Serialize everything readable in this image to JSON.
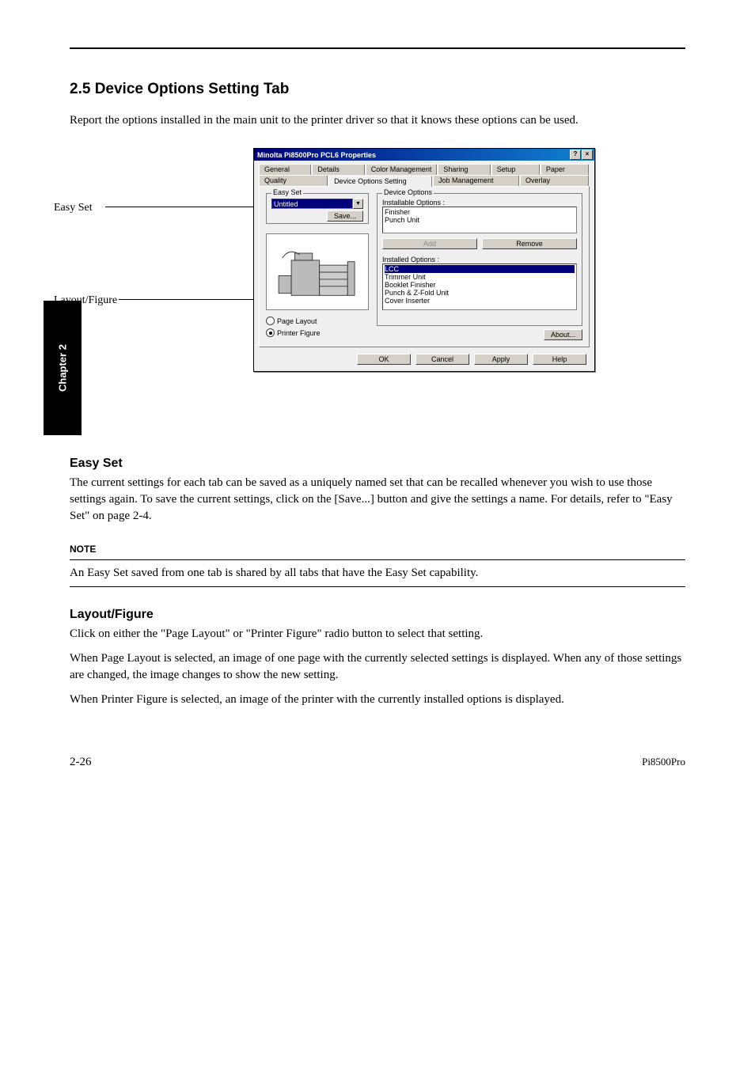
{
  "chapter_tab": "Chapter 2",
  "page_title_top": "",
  "section": {
    "heading": "2.5 Device Options Setting Tab",
    "intro": "Report the options installed in the main unit to the printer driver so that it knows these options can be used."
  },
  "figure": {
    "label_easyset": "Easy Set",
    "label_layout_figure": "Layout/Figure"
  },
  "dialog": {
    "title": "Minolta Pi8500Pro PCL6 Properties",
    "tabs_row1": [
      "General",
      "Details",
      "Color Management",
      "Sharing",
      "Setup",
      "Paper"
    ],
    "tabs_row2": [
      "Quality",
      "Device Options Setting",
      "Job Management",
      "Overlay"
    ],
    "active_tab": "Device Options Setting",
    "easy_set": {
      "group": "Easy Set",
      "combo_value": "Untitled",
      "save_btn": "Save..."
    },
    "layout_radio": {
      "page_layout": "Page Layout",
      "printer_figure": "Printer Figure"
    },
    "device_options": {
      "group": "Device Options",
      "installable_label": "Installable Options :",
      "installable_items": [
        "Finisher",
        "Punch Unit"
      ],
      "add_btn": "Add",
      "remove_btn": "Remove",
      "installed_label": "Installed Options :",
      "installed_items": [
        "LCC",
        "Trimmer Unit",
        "Booklet Finisher",
        "Punch & Z-Fold Unit",
        "Cover Inserter"
      ]
    },
    "about_btn": "About...",
    "buttons": {
      "ok": "OK",
      "cancel": "Cancel",
      "apply": "Apply",
      "help": "Help"
    }
  },
  "easy_set_section": {
    "heading": "Easy Set",
    "body": "The current settings for each tab can be saved as a uniquely named set that can be recalled whenever you wish to use those settings again. To save the current settings,  click on the [Save...] button and give the settings a name. For details, refer to \"Easy Set\" on page 2-4.",
    "note_label": "NOTE",
    "note_body": "An Easy Set saved from one tab is shared by all tabs that have the Easy Set capability."
  },
  "layout_figure_section": {
    "heading": "Layout/Figure",
    "body1": "Click on either the \"Page Layout\" or \"Printer Figure\" radio button to select that setting.",
    "body2": "When Page Layout is selected, an image of one page with the currently selected settings is displayed. When any of those settings are changed, the image changes to show the new setting.",
    "body3": "When Printer Figure is selected, an image of the printer with the currently installed options is displayed."
  },
  "footer": {
    "page_num": "2-26",
    "product": "Pi8500Pro"
  }
}
